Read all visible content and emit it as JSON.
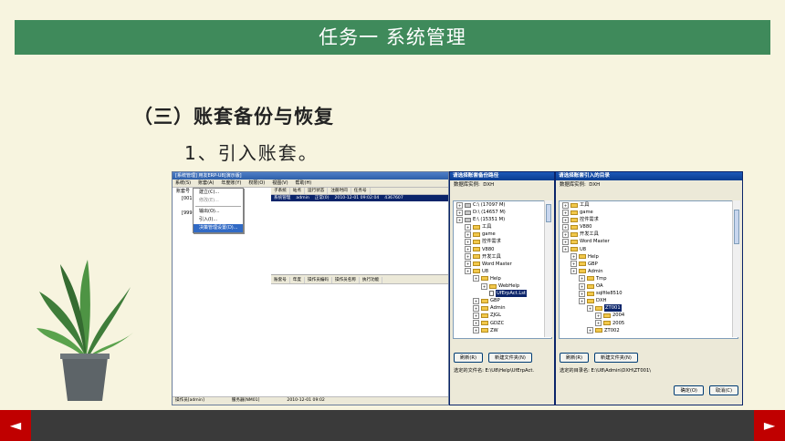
{
  "slide": {
    "banner_title": "任务一  系统管理",
    "section_heading": "（三）账套备份与恢复",
    "sub_heading": "1、引入账套。",
    "nav_prev": "◄",
    "nav_next": "►"
  },
  "app": {
    "window_title": "[系统管理] 用友ERP-U8[演示版]",
    "menu": [
      "系统(S)",
      "账套(A)",
      "年度账(Y)",
      "权限(O)",
      "视图(V)",
      "帮助(H)"
    ],
    "tree": [
      "账套号",
      "[001]",
      "[999]"
    ],
    "context_menu": [
      "建立(C)...",
      "修改(E)...",
      "输出(O)...",
      "引入(I)...",
      "决策管理设置(D)..."
    ],
    "context_highlighted": "决策管理设置(D)...",
    "table_headers": [
      "子系统",
      "站点",
      "运行状态",
      "注册时间",
      "任务号"
    ],
    "table_row": [
      "系统管理",
      "admin",
      "正常(0)",
      "2010-12-01 09:02:04",
      "4367607"
    ],
    "lower_headers": [
      "账套号",
      "年度",
      "操作员编码",
      "操作员名称",
      "执行功能"
    ],
    "status_items": [
      "操作员[admin]",
      "服务器[NM01]",
      "2010-12-01 09:02"
    ]
  },
  "dialog1": {
    "title": "请选择账套备份路径",
    "instance_label": "数据库实例:",
    "instance_value": "DXH",
    "tree": [
      {
        "label": "C:\\  (17097 M)",
        "icon": "drive"
      },
      {
        "label": "D:\\  (14657 M)",
        "icon": "drive"
      },
      {
        "label": "E:\\  (15351 M)",
        "icon": "drive"
      },
      {
        "label": "工具",
        "icon": "folder"
      },
      {
        "label": "game",
        "icon": "folder"
      },
      {
        "label": "控件需求",
        "icon": "folder"
      },
      {
        "label": "V880",
        "icon": "folder"
      },
      {
        "label": "开发工具",
        "icon": "folder"
      },
      {
        "label": "Word Master",
        "icon": "folder"
      },
      {
        "label": "U8",
        "icon": "folder"
      },
      {
        "label": "Help",
        "icon": "folder"
      },
      {
        "label": "WebHelp",
        "icon": "folder"
      },
      {
        "label": "UfErpAct.Lst",
        "icon": "file",
        "selected": true
      },
      {
        "label": "GBP",
        "icon": "folder"
      },
      {
        "label": "Admin",
        "icon": "folder"
      },
      {
        "label": "ZJGL",
        "icon": "folder"
      },
      {
        "label": "GDZC",
        "icon": "folder"
      },
      {
        "label": "ZW",
        "icon": "folder"
      }
    ],
    "refresh_button": "刷新(R)",
    "new_folder_button": "新建文件夹(N)",
    "selected_path": "选定的文件名: E:\\U8\\Help\\UfErpAct."
  },
  "dialog2": {
    "title": "请选择账套引入的目录",
    "instance_label": "数据库实例:",
    "instance_value": "DXH",
    "tree": [
      {
        "label": "工具",
        "icon": "folder"
      },
      {
        "label": "game",
        "icon": "folder"
      },
      {
        "label": "控件需求",
        "icon": "folder"
      },
      {
        "label": "V880",
        "icon": "folder"
      },
      {
        "label": "开发工具",
        "icon": "folder"
      },
      {
        "label": "Word Master",
        "icon": "folder"
      },
      {
        "label": "U8",
        "icon": "folder"
      },
      {
        "label": "Help",
        "icon": "folder"
      },
      {
        "label": "GBP",
        "icon": "folder"
      },
      {
        "label": "Admin",
        "icon": "folder"
      },
      {
        "label": "Tmp",
        "icon": "folder"
      },
      {
        "label": "OA",
        "icon": "folder"
      },
      {
        "label": "sqlfile8510",
        "icon": "folder"
      },
      {
        "label": "DXH",
        "icon": "folder"
      },
      {
        "label": "ZT001",
        "icon": "folder",
        "selected": true
      },
      {
        "label": "2004",
        "icon": "folder"
      },
      {
        "label": "2005",
        "icon": "folder"
      },
      {
        "label": "ZT002",
        "icon": "folder"
      }
    ],
    "refresh_button": "刷新(R)",
    "new_folder_button": "新建文件夹(N)",
    "selected_path": "选定的目录名: E:\\U8\\Admin\\DXH\\ZT001\\",
    "ok_button": "确定(O)",
    "cancel_button": "取消(C)"
  },
  "colors": {
    "banner": "#3f8a5b",
    "background": "#f7f4df",
    "nav": "#c00000",
    "footer": "#3a3a3a"
  }
}
